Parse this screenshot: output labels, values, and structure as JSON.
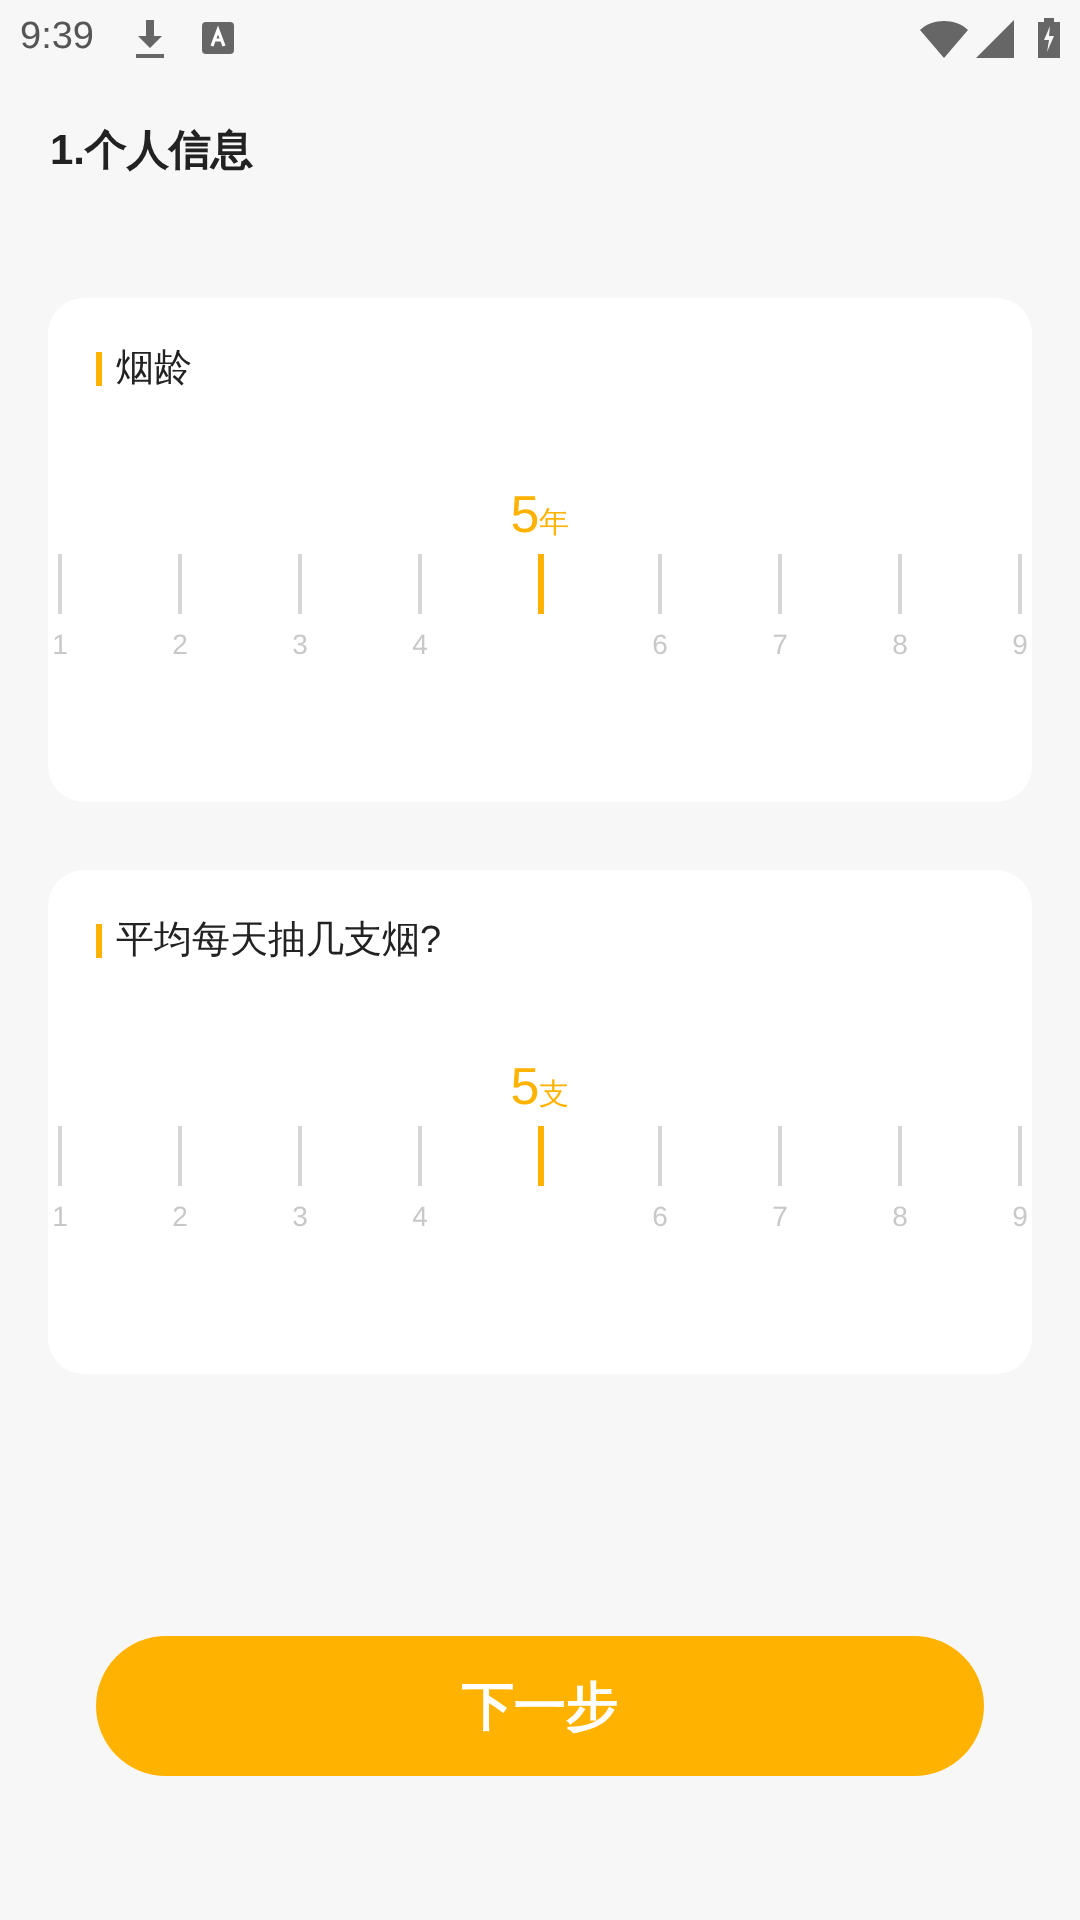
{
  "status_bar": {
    "time": "9:39"
  },
  "title": "1.个人信息",
  "cards": [
    {
      "label": "烟龄",
      "value": "5",
      "unit": "年",
      "ticks": [
        {
          "label": "1",
          "selected": false
        },
        {
          "label": "2",
          "selected": false
        },
        {
          "label": "3",
          "selected": false
        },
        {
          "label": "4",
          "selected": false
        },
        {
          "selected": true
        },
        {
          "label": "6",
          "selected": false
        },
        {
          "label": "7",
          "selected": false
        },
        {
          "label": "8",
          "selected": false
        },
        {
          "label": "9",
          "selected": false
        }
      ]
    },
    {
      "label": "平均每天抽几支烟?",
      "value": "5",
      "unit": "支",
      "ticks": [
        {
          "label": "1",
          "selected": false
        },
        {
          "label": "2",
          "selected": false
        },
        {
          "label": "3",
          "selected": false
        },
        {
          "label": "4",
          "selected": false
        },
        {
          "selected": true
        },
        {
          "label": "6",
          "selected": false
        },
        {
          "label": "7",
          "selected": false
        },
        {
          "label": "8",
          "selected": false
        },
        {
          "label": "9",
          "selected": false
        }
      ]
    }
  ],
  "next_button": "下一步"
}
